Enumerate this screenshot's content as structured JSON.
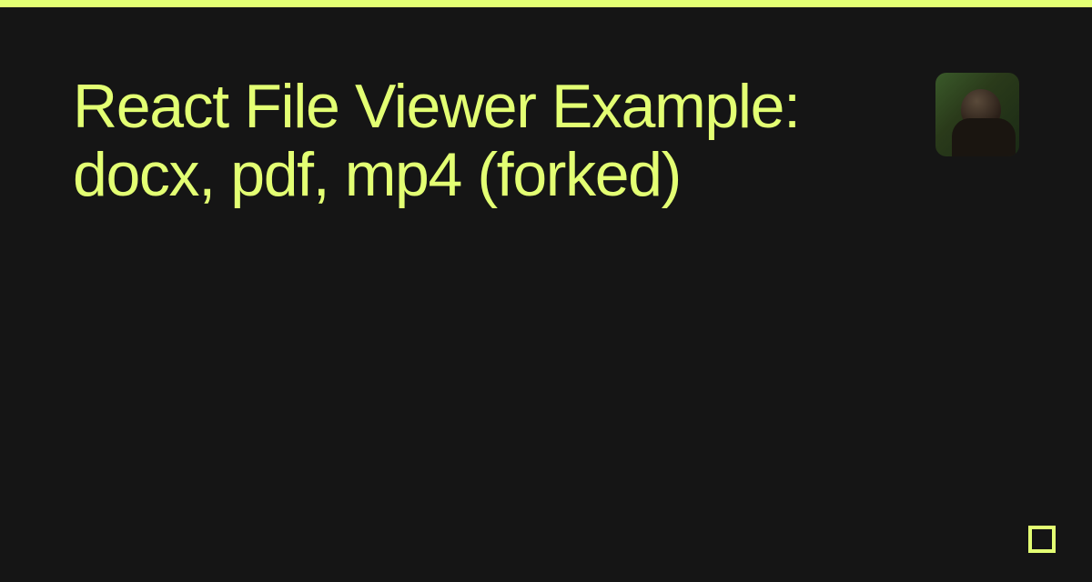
{
  "colors": {
    "accent": "#e3ff73",
    "background": "#151515"
  },
  "header": {
    "title": "React File Viewer Example: docx, pdf, mp4 (forked)"
  },
  "avatar": {
    "description": "user-avatar"
  },
  "icon": {
    "name": "square-icon"
  }
}
